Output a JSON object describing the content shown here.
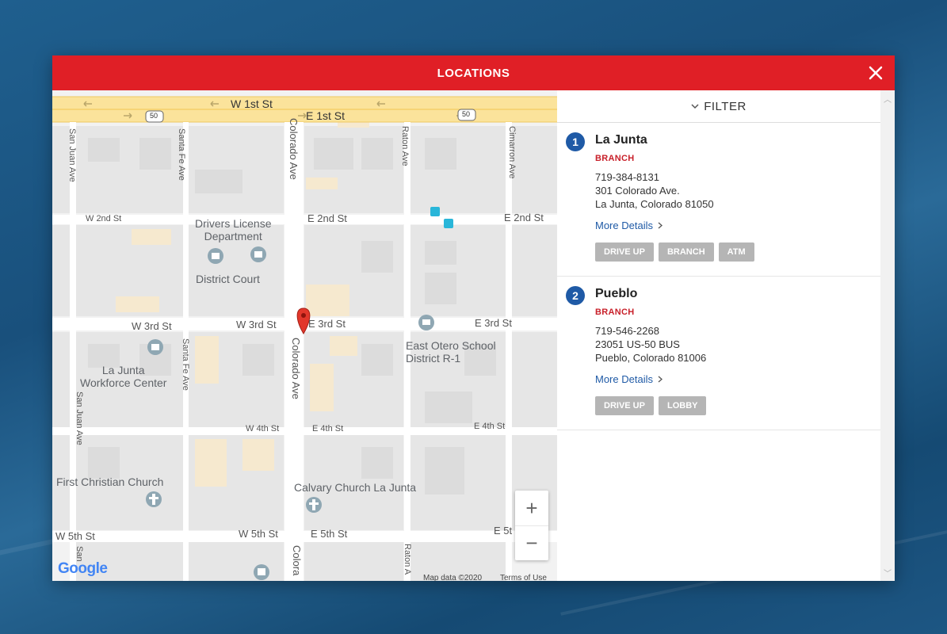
{
  "modal": {
    "title": "LOCATIONS"
  },
  "filter": {
    "label": "FILTER"
  },
  "map": {
    "streets": {
      "w1st": "W 1st St",
      "e1st": "E 1st St",
      "w2nd": "W 2nd St",
      "e2nd_a": "E 2nd St",
      "e2nd_b": "E 2nd St",
      "w3rd_a": "W 3rd St",
      "w3rd_b": "W 3rd St",
      "e3rd_a": "E 3rd St",
      "e3rd_b": "E 3rd St",
      "w4th": "W 4th St",
      "e4th_a": "E 4th St",
      "e4th_b": "E 4th St",
      "w5th_a": "W 5th St",
      "w5th_b": "W 5th St",
      "e5th_a": "E 5th St",
      "e5th_b": "E 5t",
      "sanjuan_a": "San Juan Ave",
      "sanjuan_b": "San Juan Ave",
      "sanjuan_c": "San",
      "santafe_a": "Santa Fe Ave",
      "santafe_b": "Santa Fe Ave",
      "colorado_a": "Colorado Ave",
      "colorado_b": "Colorado Ave",
      "colorado_c": "Colora",
      "raton_a": "Raton Ave",
      "raton_b": "Raton A",
      "cimarron": "Cimarron Ave",
      "route": "50"
    },
    "pois": {
      "drivers_license": "Drivers License\nDepartment",
      "district_court": "District Court",
      "la_junta_workforce": "La Junta\nWorkforce Center",
      "east_otero": "East Otero School\nDistrict R-1",
      "first_christian": "First Christian Church",
      "calvary": "Calvary Church La Junta"
    },
    "zoom_in": "+",
    "zoom_out": "−",
    "logo": "Google",
    "attribution": "Map data ©2020",
    "terms": "Terms of Use"
  },
  "locations": [
    {
      "number": "1",
      "name": "La Junta",
      "type": "BRANCH",
      "phone": "719-384-8131",
      "address1": "301 Colorado Ave.",
      "address2": "La Junta, Colorado 81050",
      "more": "More Details",
      "tags": [
        "DRIVE UP",
        "BRANCH",
        "ATM"
      ]
    },
    {
      "number": "2",
      "name": "Pueblo",
      "type": "BRANCH",
      "phone": "719-546-2268",
      "address1": "23051 US-50 BUS",
      "address2": "Pueblo, Colorado 81006",
      "more": "More Details",
      "tags": [
        "DRIVE UP",
        "LOBBY"
      ]
    }
  ],
  "colors": {
    "header": "#e01f26",
    "accent": "#1f5aa6",
    "branch": "#c8202a",
    "tag": "#b5b5b5"
  }
}
